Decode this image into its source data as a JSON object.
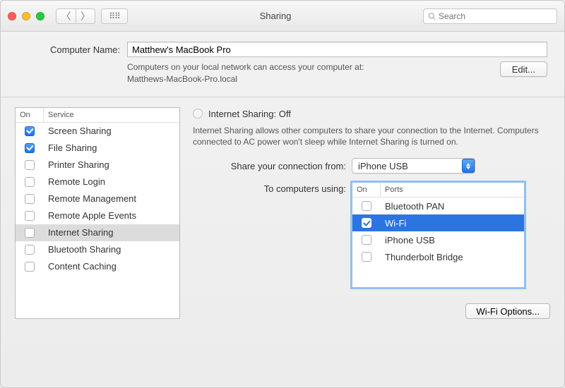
{
  "window": {
    "title": "Sharing",
    "search_placeholder": "Search"
  },
  "computerName": {
    "label": "Computer Name:",
    "value": "Matthew's MacBook Pro",
    "description_line1": "Computers on your local network can access your computer at:",
    "description_line2": "Matthews-MacBook-Pro.local",
    "edit_button": "Edit..."
  },
  "services": {
    "header_on": "On",
    "header_service": "Service",
    "items": [
      {
        "label": "Screen Sharing",
        "checked": true,
        "selected": false
      },
      {
        "label": "File Sharing",
        "checked": true,
        "selected": false
      },
      {
        "label": "Printer Sharing",
        "checked": false,
        "selected": false
      },
      {
        "label": "Remote Login",
        "checked": false,
        "selected": false
      },
      {
        "label": "Remote Management",
        "checked": false,
        "selected": false
      },
      {
        "label": "Remote Apple Events",
        "checked": false,
        "selected": false
      },
      {
        "label": "Internet Sharing",
        "checked": false,
        "selected": true
      },
      {
        "label": "Bluetooth Sharing",
        "checked": false,
        "selected": false
      },
      {
        "label": "Content Caching",
        "checked": false,
        "selected": false
      }
    ]
  },
  "detail": {
    "title": "Internet Sharing: Off",
    "description": "Internet Sharing allows other computers to share your connection to the Internet. Computers connected to AC power won't sleep while Internet Sharing is turned on.",
    "share_from_label": "Share your connection from:",
    "share_from_value": "iPhone USB",
    "to_computers_label": "To computers using:"
  },
  "ports": {
    "header_on": "On",
    "header_ports": "Ports",
    "items": [
      {
        "label": "Bluetooth PAN",
        "checked": false,
        "selected": false
      },
      {
        "label": "Wi-Fi",
        "checked": true,
        "selected": true
      },
      {
        "label": "iPhone USB",
        "checked": false,
        "selected": false
      },
      {
        "label": "Thunderbolt Bridge",
        "checked": false,
        "selected": false
      }
    ]
  },
  "footer": {
    "wifi_options": "Wi-Fi Options..."
  }
}
